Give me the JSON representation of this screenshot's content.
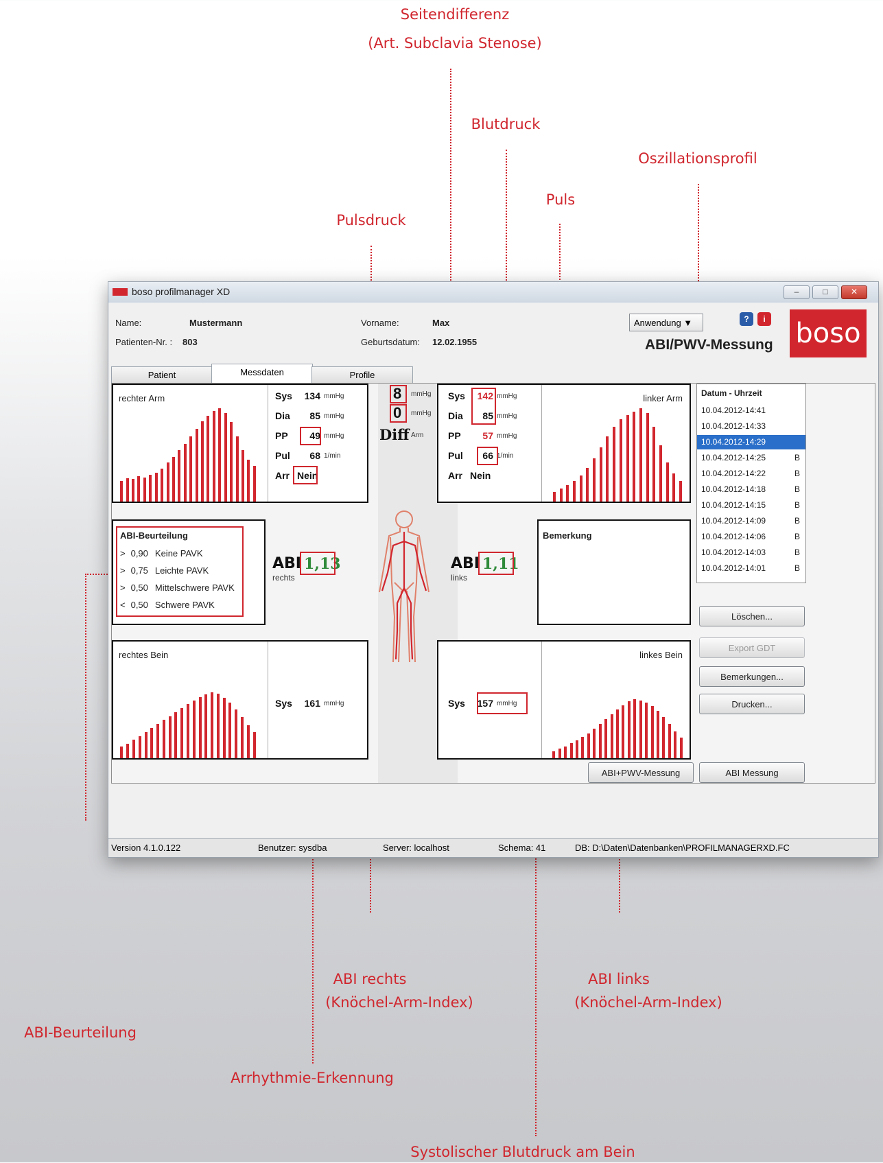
{
  "callouts": {
    "seitendifferenz_line1": "Seitendifferenz",
    "seitendifferenz_line2": "(Art. Subclavia Stenose)",
    "blutdruck": "Blutdruck",
    "oszillationsprofil": "Oszillationsprofil",
    "puls": "Puls",
    "pulsdruck": "Pulsdruck",
    "abi_rechts_line1": "ABI rechts",
    "abi_rechts_line2": "(Knöchel-Arm-Index)",
    "abi_links_line1": "ABI links",
    "abi_links_line2": "(Knöchel-Arm-Index)",
    "abi_beurteilung": "ABI-Beurteilung",
    "arrhythmie": "Arrhythmie-Erkennung",
    "systolisch_bein": "Systolischer Blutdruck am Bein"
  },
  "window": {
    "title": "boso profilmanager XD",
    "minimize": "–",
    "maximize": "□",
    "close": "✕"
  },
  "header": {
    "name_label": "Name:",
    "name_value": "Mustermann",
    "patnr_label": "Patienten-Nr. :",
    "patnr_value": "803",
    "vorname_label": "Vorname:",
    "vorname_value": "Max",
    "geburt_label": "Geburtsdatum:",
    "geburt_value": "12.02.1955",
    "dropdown": "Anwendung ▼",
    "mode_title": "ABI/PWV-Messung",
    "logo": "boso"
  },
  "tabs": [
    "Patient",
    "Messdaten",
    "Profile"
  ],
  "right_arm": {
    "title": "rechter Arm",
    "sys_label": "Sys",
    "sys": "134",
    "sys_unit": "mmHg",
    "dia_label": "Dia",
    "dia": "85",
    "dia_unit": "mmHg",
    "pp_label": "PP",
    "pp": "49",
    "pp_unit": "mmHg",
    "pul_label": "Pul",
    "pul": "68",
    "pul_unit": "1/min",
    "arr_label": "Arr",
    "arr": "Nein"
  },
  "left_arm": {
    "title": "linker Arm",
    "sys_label": "Sys",
    "sys": "142",
    "sys_unit": "mmHg",
    "dia_label": "Dia",
    "dia": "85",
    "dia_unit": "mmHg",
    "pp_label": "PP",
    "pp": "57",
    "pp_unit": "mmHg",
    "pul_label": "Pul",
    "pul": "66",
    "pul_unit": "1/min",
    "arr_label": "Arr",
    "arr": "Nein"
  },
  "diff": {
    "sys": "8",
    "sys_unit": "mmHg",
    "dia": "0",
    "dia_unit": "mmHg",
    "label": "Diff",
    "sub": "Arm"
  },
  "abi_legend": {
    "title": "ABI-Beurteilung",
    "rows": [
      {
        "op": ">",
        "val": "0,90",
        "text": "Keine PAVK"
      },
      {
        "op": ">",
        "val": "0,75",
        "text": "Leichte PAVK"
      },
      {
        "op": ">",
        "val": "0,50",
        "text": "Mittelschwere PAVK"
      },
      {
        "op": "<",
        "val": "0,50",
        "text": "Schwere PAVK"
      }
    ]
  },
  "abi_right": {
    "label": "ABI",
    "value": "1,13",
    "side": "rechts"
  },
  "abi_left": {
    "label": "ABI",
    "value": "1,11",
    "side": "links"
  },
  "bemerkung": {
    "title": "Bemerkung"
  },
  "right_leg": {
    "title": "rechtes Bein",
    "sys_label": "Sys",
    "sys": "161",
    "sys_unit": "mmHg"
  },
  "left_leg": {
    "title": "linkes Bein",
    "sys_label": "Sys",
    "sys": "157",
    "sys_unit": "mmHg"
  },
  "history": {
    "header": "Datum - Uhrzeit",
    "rows": [
      {
        "date": "10.04.2012-14:41",
        "flag": ""
      },
      {
        "date": "10.04.2012-14:33",
        "flag": ""
      },
      {
        "date": "10.04.2012-14:29",
        "flag": ""
      },
      {
        "date": "10.04.2012-14:25",
        "flag": "B"
      },
      {
        "date": "10.04.2012-14:22",
        "flag": "B"
      },
      {
        "date": "10.04.2012-14:18",
        "flag": "B"
      },
      {
        "date": "10.04.2012-14:15",
        "flag": "B"
      },
      {
        "date": "10.04.2012-14:09",
        "flag": "B"
      },
      {
        "date": "10.04.2012-14:06",
        "flag": "B"
      },
      {
        "date": "10.04.2012-14:03",
        "flag": "B"
      },
      {
        "date": "10.04.2012-14:01",
        "flag": "B"
      }
    ],
    "selected_index": 2
  },
  "buttons": {
    "loeschen": "Löschen...",
    "export": "Export GDT",
    "bemerkungen": "Bemerkungen...",
    "drucken": "Drucken...",
    "abi_pwv": "ABI+PWV-Messung",
    "abi_messung": "ABI Messung"
  },
  "status": {
    "version": "Version 4.1.0.122",
    "benutzer": "Benutzer: sysdba",
    "server": "Server: localhost",
    "schema": "Schema: 41",
    "db": "DB: D:\\Daten\\Datenbanken\\PROFILMANAGERXD.FC"
  },
  "waveforms": {
    "right_arm": [
      0.22,
      0.25,
      0.24,
      0.27,
      0.26,
      0.29,
      0.31,
      0.35,
      0.42,
      0.48,
      0.55,
      0.62,
      0.7,
      0.78,
      0.86,
      0.92,
      0.97,
      1.0,
      0.95,
      0.85,
      0.7,
      0.55,
      0.45,
      0.38
    ],
    "left_arm": [
      0.1,
      0.14,
      0.18,
      0.22,
      0.28,
      0.36,
      0.46,
      0.58,
      0.7,
      0.8,
      0.88,
      0.93,
      0.96,
      1.0,
      0.95,
      0.8,
      0.6,
      0.42,
      0.3,
      0.22
    ],
    "right_leg": [
      0.18,
      0.22,
      0.28,
      0.33,
      0.4,
      0.46,
      0.52,
      0.58,
      0.64,
      0.7,
      0.76,
      0.82,
      0.88,
      0.93,
      0.97,
      1.0,
      0.98,
      0.92,
      0.84,
      0.74,
      0.62,
      0.5,
      0.4
    ],
    "left_leg": [
      0.12,
      0.16,
      0.2,
      0.25,
      0.3,
      0.36,
      0.42,
      0.5,
      0.58,
      0.66,
      0.74,
      0.82,
      0.9,
      0.96,
      1.0,
      0.98,
      0.94,
      0.88,
      0.8,
      0.7,
      0.58,
      0.45,
      0.35
    ]
  },
  "colors": {
    "accent": "#d0262e",
    "abi_green": "#2f8a3a",
    "selection": "#2a6fc9"
  }
}
